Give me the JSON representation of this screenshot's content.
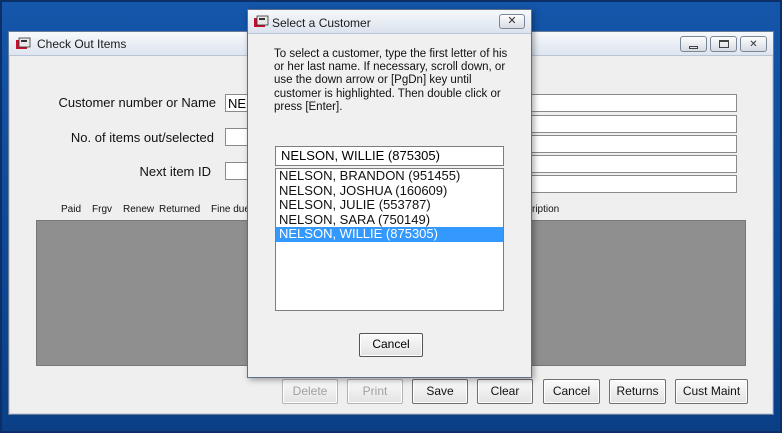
{
  "main_window": {
    "title": "Check Out Items",
    "customer_label": "Customer number or Name",
    "customer_value": "NEL",
    "items_label": "No. of items out/selected",
    "next_label": "Next item ID",
    "columns": [
      "Paid",
      "Frgv",
      "Renew",
      "Returned",
      "Fine due",
      "ription"
    ],
    "buttons": {
      "delete": "Delete",
      "print": "Print",
      "save": "Save",
      "clear": "Clear",
      "cancel": "Cancel",
      "returns": "Returns",
      "cust_maint": "Cust Maint"
    }
  },
  "dialog": {
    "title": "Select a Customer",
    "instructions": "To select a customer, type the first letter of his or her last name.  If necessary, scroll down, or use the down arrow or [PgDn] key until customer is highlighted.  Then double click or press [Enter].",
    "selected_value": "NELSON, WILLIE  (875305)",
    "items": [
      "NELSON, BRANDON  (951455)",
      "NELSON, JOSHUA  (160609)",
      "NELSON, JULIE  (553787)",
      "NELSON, SARA  (750149)",
      "NELSON, WILLIE  (875305)"
    ],
    "selected_index": 4,
    "cancel_label": "Cancel"
  },
  "icons": {
    "app": "app-icon",
    "minimize": "minimize-icon",
    "maximize": "maximize-icon",
    "close": "close-icon"
  },
  "colors": {
    "selection": "#3399ff",
    "desktop": "#0b4a9a",
    "grid": "#8f8f8f"
  }
}
